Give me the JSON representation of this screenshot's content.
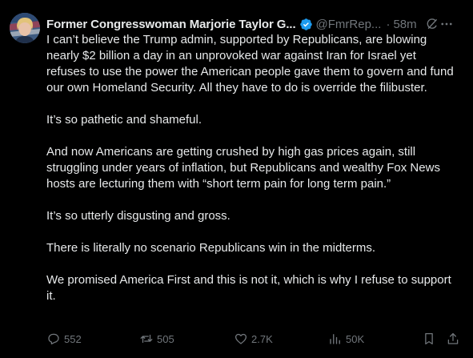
{
  "author": {
    "display_name": "Former Congresswoman Marjorie Taylor G...",
    "handle": "@FmrRep...",
    "separator": "·",
    "time": "58m"
  },
  "icons": {
    "verified": "verified-badge-icon",
    "grok": "grok-icon",
    "more": "more-icon",
    "reply": "reply-icon",
    "repost": "repost-icon",
    "like": "like-icon",
    "views": "views-icon",
    "bookmark": "bookmark-icon",
    "share": "share-icon"
  },
  "colors": {
    "background": "#000000",
    "text": "#e7e9ea",
    "muted": "#71767b",
    "verified": "#1d9bf0"
  },
  "body": {
    "paragraphs": [
      "I can’t believe the Trump admin, supported by Republicans, are blowing nearly $2 billion a day in an unprovoked war against Iran for Israel yet refuses to use the power the American people gave them to govern and fund our own Homeland Security. All they have to do is override the filibuster.",
      "It’s so pathetic and shameful.",
      "And now Americans are getting crushed by high gas prices again, still struggling under years of inflation, but Republicans and wealthy Fox News hosts are lecturing them with “short term pain for long term pain.”",
      "It’s so utterly disgusting and gross.",
      "There is literally no scenario Republicans win in the midterms.",
      "We promised America First and this is not it, which is why I refuse to support it."
    ]
  },
  "actions": {
    "replies": "552",
    "reposts": "505",
    "likes": "2.7K",
    "views": "50K"
  }
}
